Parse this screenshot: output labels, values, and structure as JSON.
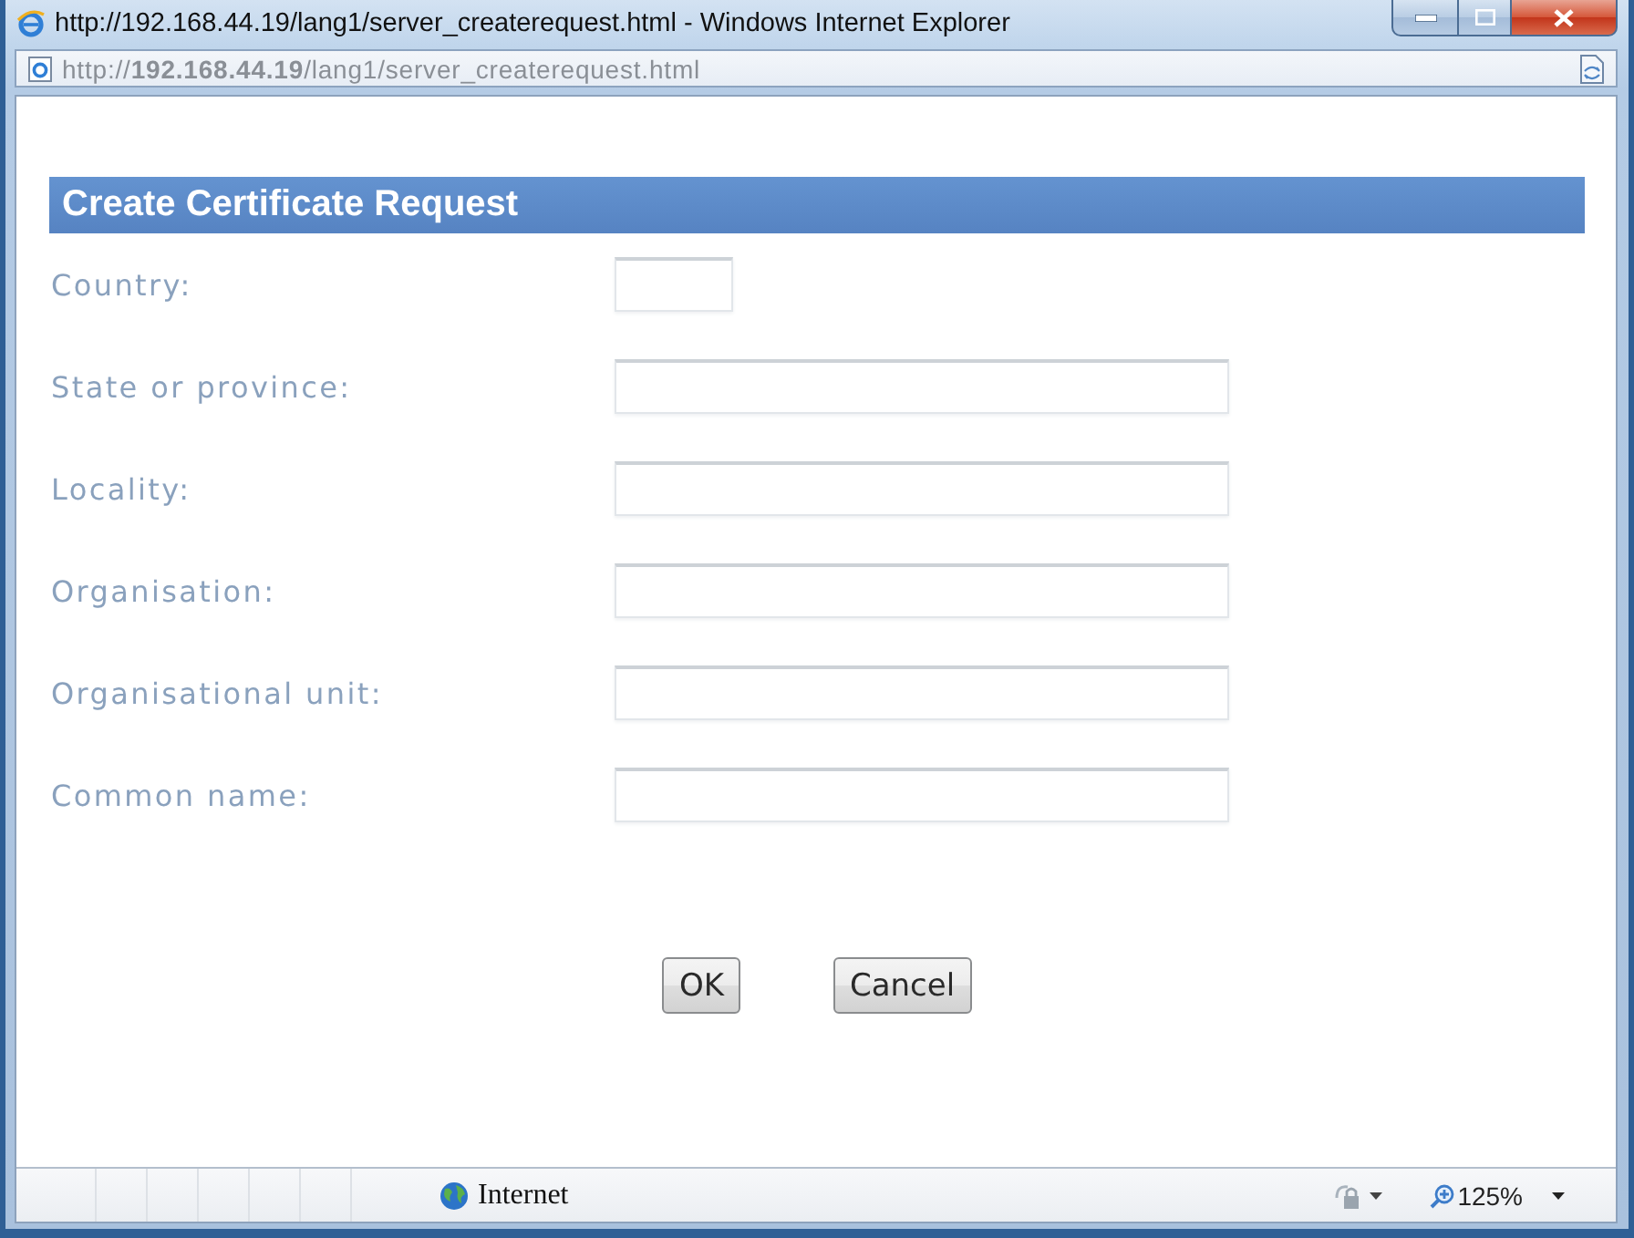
{
  "window": {
    "title": "http://192.168.44.19/lang1/server_createrequest.html - Windows Internet Explorer"
  },
  "address_bar": {
    "url": "http://**192.168.44.19**/lang1/server_createrequest.html"
  },
  "page": {
    "heading": "Create Certificate Request",
    "fields": [
      {
        "label": "Country:",
        "kind": "short"
      },
      {
        "label": "State or province:",
        "kind": "long"
      },
      {
        "label": "Locality:",
        "kind": "long"
      },
      {
        "label": "Organisation:",
        "kind": "long"
      },
      {
        "label": "Organisational unit:",
        "kind": "long"
      },
      {
        "label": "Common name:",
        "kind": "long"
      }
    ],
    "buttons": [
      "OK",
      "Cancel"
    ]
  },
  "status_bar": {
    "zone": "Internet",
    "zoom": "125%"
  }
}
